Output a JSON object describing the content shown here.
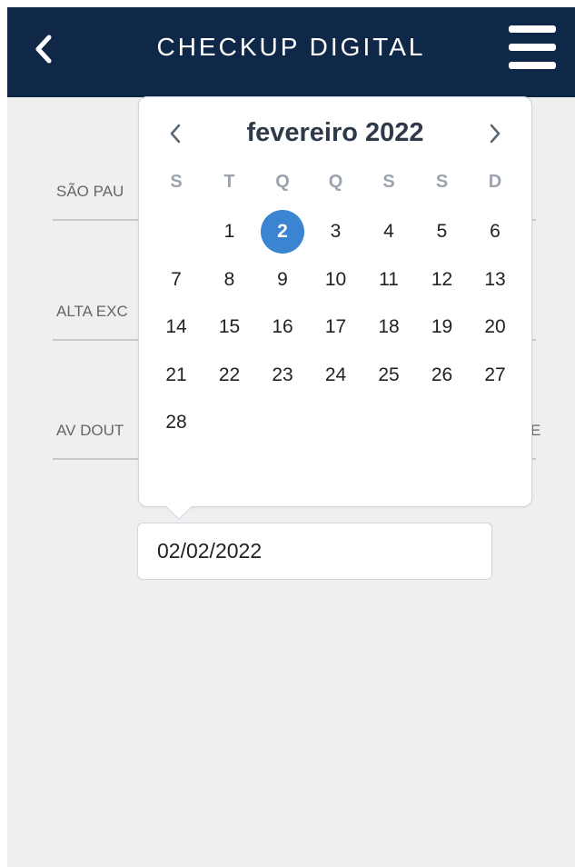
{
  "header": {
    "title": "CHECKUP DIGITAL",
    "back_icon": "chevron-left-icon",
    "menu_icon": "hamburger-menu-icon",
    "background_color": "#0f2847"
  },
  "form": {
    "fields": [
      {
        "text": "SÃO PAU"
      },
      {
        "text": "ALTA EXC"
      },
      {
        "text": "AV DOUT"
      }
    ],
    "field3_tail": "E"
  },
  "calendar": {
    "month_label": "fevereiro 2022",
    "prev_icon": "chevron-left-icon",
    "next_icon": "chevron-right-icon",
    "weekdays": [
      "S",
      "T",
      "Q",
      "Q",
      "S",
      "S",
      "D"
    ],
    "first_day_column": 1,
    "days_in_month": 28,
    "selected_day": 2,
    "selected_color": "#3b84d1"
  },
  "date_input": {
    "value": "02/02/2022"
  }
}
